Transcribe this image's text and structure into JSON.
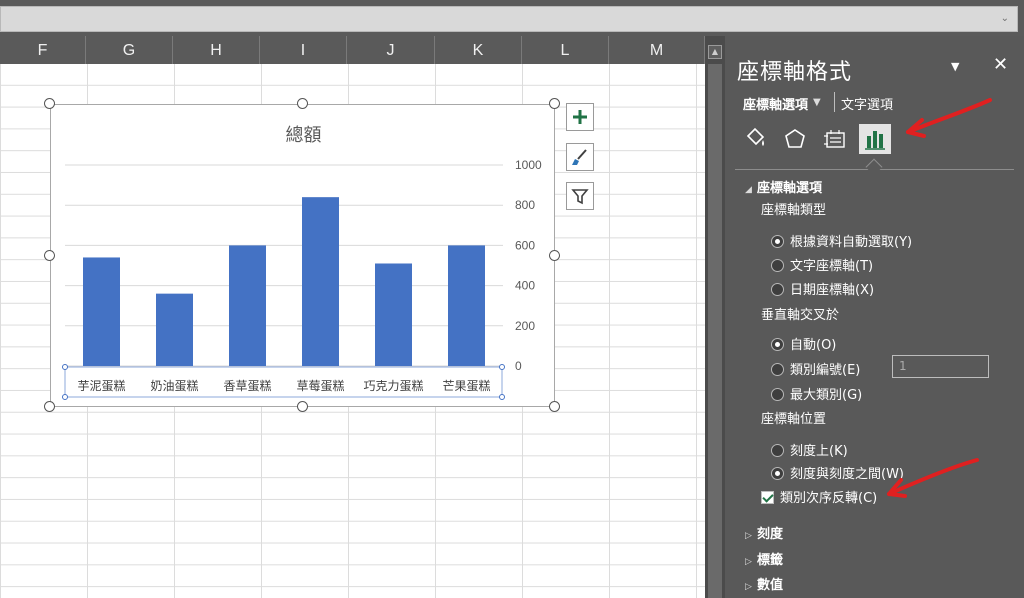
{
  "formula_bar": {
    "value": ""
  },
  "columns": [
    "F",
    "G",
    "H",
    "I",
    "J",
    "K",
    "L",
    "M"
  ],
  "chart_data": {
    "type": "bar",
    "title": "總額",
    "categories": [
      "芋泥蛋糕",
      "奶油蛋糕",
      "香草蛋糕",
      "草莓蛋糕",
      "巧克力蛋糕",
      "芒果蛋糕"
    ],
    "values": [
      540,
      360,
      600,
      840,
      510,
      600
    ],
    "y_ticks": [
      "0",
      "200",
      "400",
      "600",
      "800",
      "1000"
    ],
    "ylim": [
      0,
      1000
    ],
    "y_axis_position": "right",
    "category_order_reversed": true,
    "grid": true,
    "bar_color": "#4472c4"
  },
  "chart_buttons": {
    "add": "chart-elements",
    "style": "chart-styles",
    "filter": "chart-filters"
  },
  "pane": {
    "title": "座標軸格式",
    "tab_axis_options": "座標軸選項",
    "tab_text_options": "文字選項",
    "section_axis_options": "座標軸選項",
    "axis_type_label": "座標軸類型",
    "axis_type_options": [
      "根據資料自動選取(Y)",
      "文字座標軸(T)",
      "日期座標軸(X)"
    ],
    "cross_label": "垂直軸交叉於",
    "cross_options": [
      "自動(O)",
      "類別編號(E)",
      "最大類別(G)"
    ],
    "cross_number_value": "1",
    "position_label": "座標軸位置",
    "position_options": [
      "刻度上(K)",
      "刻度與刻度之間(W)"
    ],
    "reverse_order_label": "類別次序反轉(C)",
    "collapsed_sections": [
      "刻度",
      "標籤",
      "數值"
    ]
  },
  "colors": {
    "accent_green": "#217346",
    "annotation_red": "#e02020",
    "bar_blue": "#4472c4"
  }
}
